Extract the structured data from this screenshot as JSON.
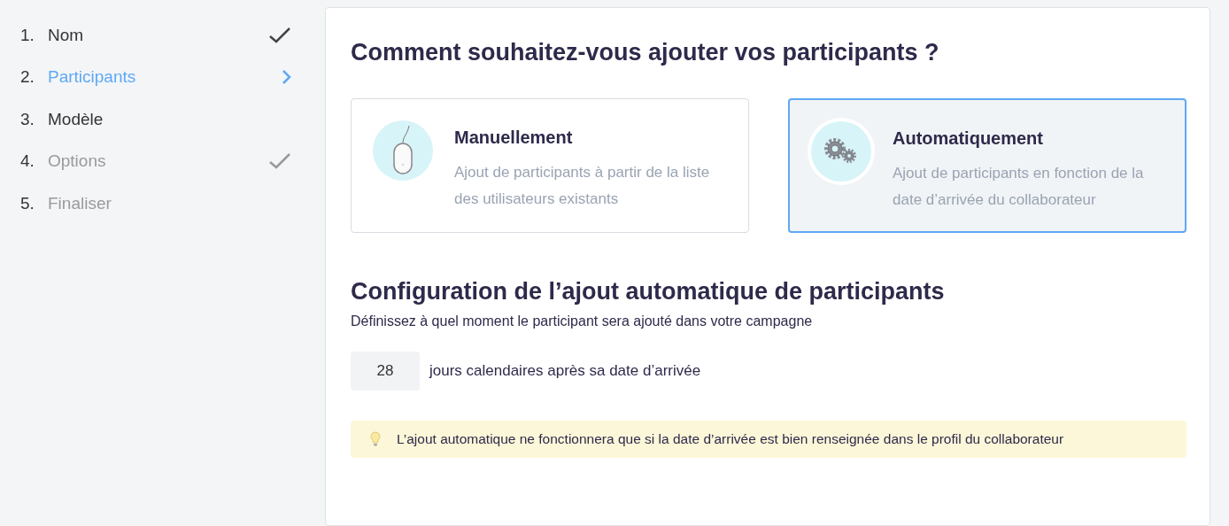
{
  "steps": [
    {
      "number": "1.",
      "label": "Nom",
      "selected": false,
      "enabled": true,
      "completed": true
    },
    {
      "number": "2.",
      "label": "Participants",
      "selected": true,
      "enabled": true,
      "completed": false
    },
    {
      "number": "3.",
      "label": "Modèle",
      "selected": false,
      "enabled": true,
      "completed": false
    },
    {
      "number": "4.",
      "label": "Options",
      "selected": false,
      "enabled": false,
      "completed": true
    },
    {
      "number": "5.",
      "label": "Finaliser",
      "selected": false,
      "enabled": false,
      "completed": false
    }
  ],
  "title": "Comment souhaitez-vous ajouter vos participants ?",
  "options": [
    {
      "kind": "mouse",
      "title": "Manuellement",
      "description": "Ajout de participants à partir de la liste des utilisateurs existants",
      "selected": false
    },
    {
      "kind": "gears",
      "title": "Automatiquement",
      "description": "Ajout de participants en fonction de la date d’arrivée du collaborateur",
      "selected": true
    }
  ],
  "config": {
    "title": "Configuration de l’ajout automatique de participants",
    "subtitle": "Définissez à quel moment le participant sera ajouté dans votre campagne",
    "days_value": "28",
    "days_label": "jours calendaires après sa date d’arrivée",
    "tip": "L’ajout automatique ne fonctionnera que si la date d’arrivée est bien renseignée dans le profil du collaborateur"
  }
}
